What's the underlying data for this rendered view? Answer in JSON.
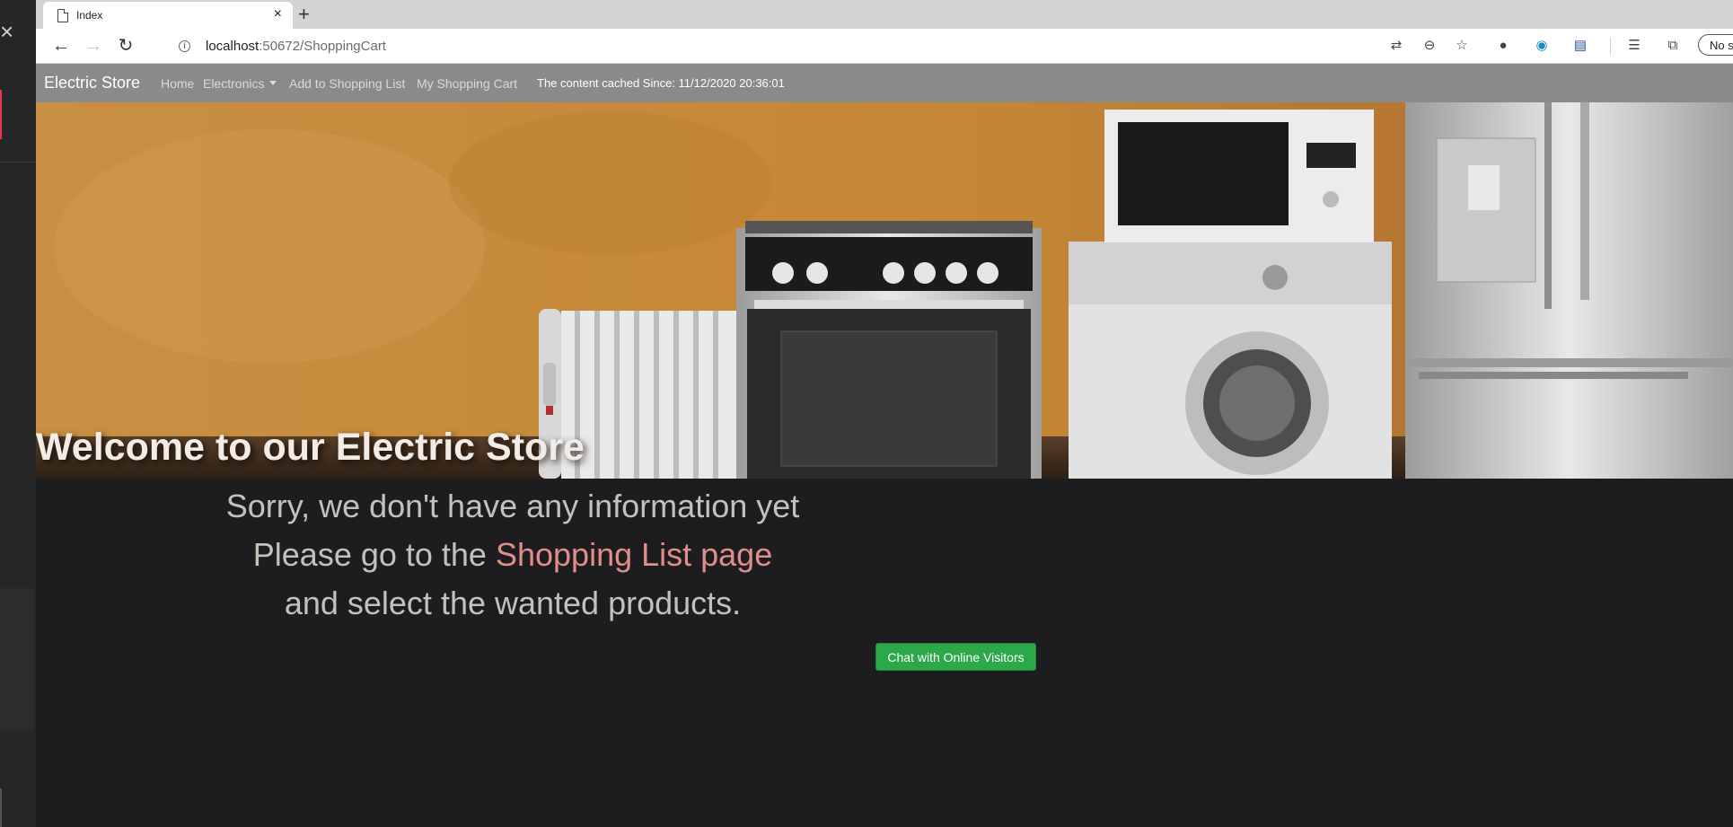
{
  "browser": {
    "tab_title": "Index",
    "tab_close": "×",
    "new_tab": "+",
    "url_host": "localhost",
    "url_path": ":50672/ShoppingCart",
    "profile_label": "No s"
  },
  "navbar": {
    "brand": "Electric Store",
    "links": [
      "Home",
      "Electronics",
      "Add to Shopping List",
      "My Shopping Cart"
    ],
    "cache_notice": "The content cached Since: 11/12/2020 20:36:01"
  },
  "hero": {
    "title": "Welcome to our Electric Store"
  },
  "content": {
    "line1": "Sorry, we don't have any information yet",
    "line2_prefix": "Please go to the ",
    "line2_link": "Shopping List page",
    "line3": "and select the wanted products.",
    "chat_button": "Chat with Online Visitors"
  },
  "colors": {
    "navbar_bg": "#8a8a8a",
    "chat_button_bg": "#2ba84a",
    "link_color": "#e08e8b",
    "page_bg": "#1d1d20"
  }
}
